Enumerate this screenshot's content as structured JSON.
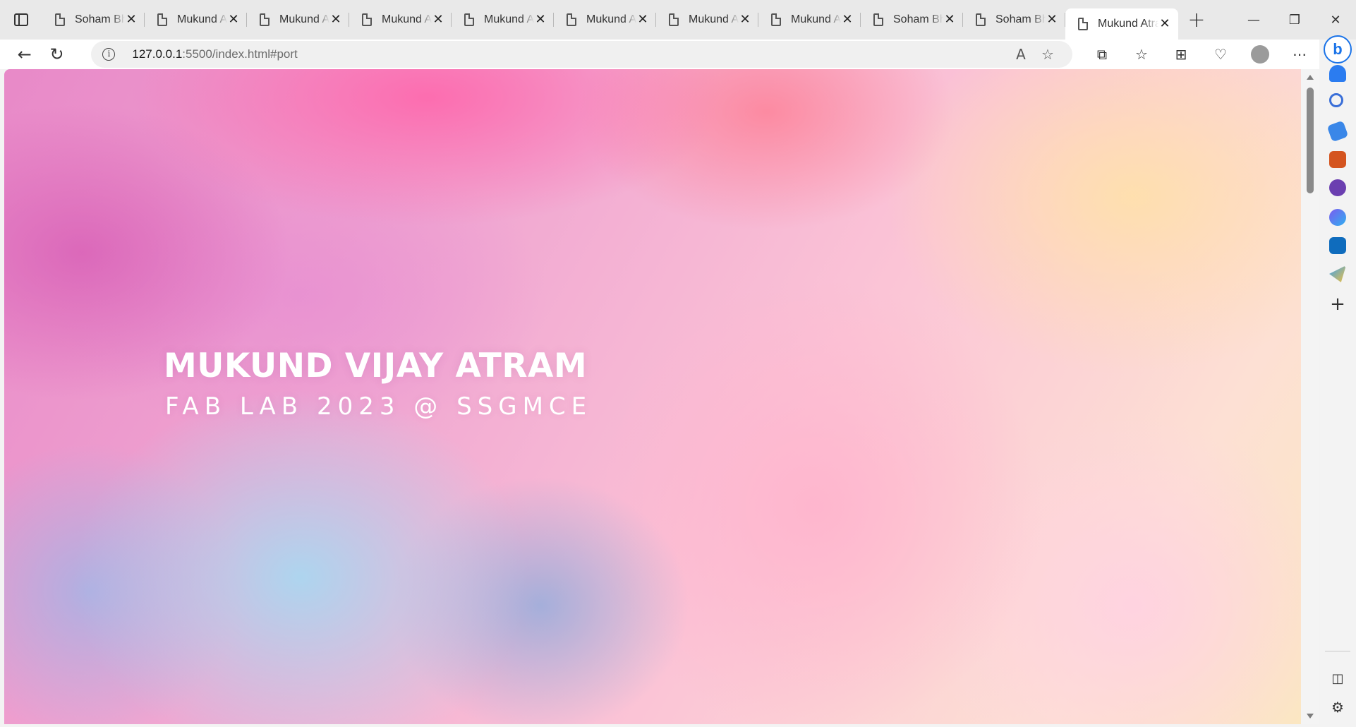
{
  "browser": {
    "tabs": [
      {
        "label": "Soham Bhagat",
        "active": false
      },
      {
        "label": "Mukund Atram",
        "active": false
      },
      {
        "label": "Mukund Atram",
        "active": false
      },
      {
        "label": "Mukund Atram",
        "active": false
      },
      {
        "label": "Mukund Atram",
        "active": false
      },
      {
        "label": "Mukund Atram",
        "active": false
      },
      {
        "label": "Mukund Atram",
        "active": false
      },
      {
        "label": "Mukund Atram",
        "active": false
      },
      {
        "label": "Soham Bhagat",
        "active": false
      },
      {
        "label": "Soham Bhagat",
        "active": false
      },
      {
        "label": "Mukund Atram",
        "active": true
      }
    ],
    "tab_close_glyph": "✕",
    "new_tab_glyph": "+",
    "window_controls": {
      "minimize": "—",
      "restore": "❐",
      "close": "✕"
    },
    "address": {
      "host": "127.0.0.1",
      "path": ":5500/index.html#port"
    },
    "nav": {
      "back": "←",
      "refresh": "↻"
    },
    "url_icons": {
      "read_aloud": "A",
      "favorite": "☆"
    },
    "toolbar_icons": {
      "split": "⧉",
      "favorites": "☆",
      "collections": "⊞",
      "performance": "♡",
      "more": "⋯"
    },
    "sidebar_icons": [
      "bell-icon",
      "search-icon",
      "tag-icon",
      "briefcase-icon",
      "chess-icon",
      "m365-icon",
      "outlook-icon",
      "send-icon"
    ],
    "sidebar_plus": "+",
    "sidebar_bottom": {
      "panel": "◫",
      "settings": "⚙"
    }
  },
  "page": {
    "title": "MUKUND VIJAY ATRAM",
    "subtitle": "FAB LAB 2023 @ SSGMCE"
  },
  "colors": {
    "accent": "#1a73e8",
    "hero_text": "#ffffff"
  }
}
